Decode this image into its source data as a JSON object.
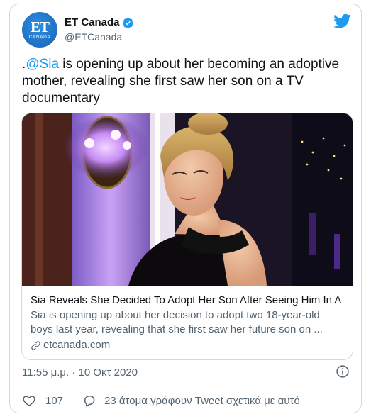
{
  "author": {
    "display_name": "ET Canada",
    "handle": "@ETCanada",
    "avatar_text": "ET",
    "avatar_subtext": "CANADA",
    "verified": true
  },
  "tweet": {
    "prefix": ".",
    "mention": "@Sia",
    "text": " is opening up about her becoming an adoptive mother, revealing she first saw her son on a TV documentary"
  },
  "link_card": {
    "title": "Sia Reveals She Decided To Adopt Her Son After Seeing Him In A ...",
    "description": "Sia is opening up about her decision to adopt two 18-year-old boys last year, revealing that she first saw her future son on ...",
    "domain": "etcanada.com"
  },
  "timestamp": "11:55 μ.μ. · 10 Οκτ 2020",
  "actions": {
    "like_count": "107",
    "reply_text": "23 άτομα γράφουν Tweet σχετικά με αυτό"
  },
  "colors": {
    "accent": "#1d9bf0",
    "text": "#0f1419",
    "secondary": "#536471",
    "border": "#cfd9de"
  },
  "icons": [
    "verified-badge-icon",
    "twitter-bird-icon",
    "link-icon",
    "info-icon",
    "heart-icon",
    "reply-bubble-icon"
  ]
}
